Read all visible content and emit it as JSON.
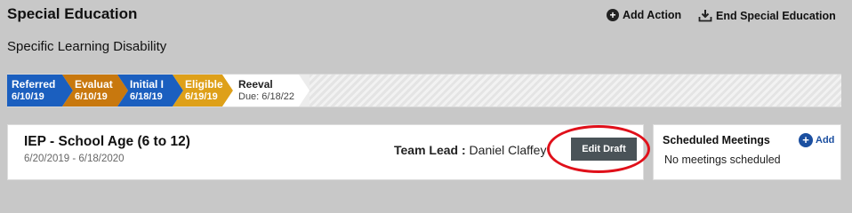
{
  "header": {
    "title": "Special Education",
    "subtitle": "Specific Learning Disability",
    "add_action": "Add Action",
    "end_special_education": "End Special Education"
  },
  "stages": [
    {
      "name": "Referred",
      "date": "6/10/19",
      "color": "#1b5fbf"
    },
    {
      "name": "Evaluat",
      "date": "6/10/19",
      "color": "#c8780e"
    },
    {
      "name": "Initial I",
      "date": "6/18/19",
      "color": "#1b5fbf"
    },
    {
      "name": "Eligible",
      "date": "6/19/19",
      "color": "#dea019"
    },
    {
      "name": "Reeval",
      "date": "Due: 6/18/22",
      "color": "#ffffff"
    }
  ],
  "iep": {
    "title": "IEP - School Age (6 to 12)",
    "dates": "6/20/2019 - 6/18/2020",
    "team_lead_label": "Team Lead :",
    "team_lead_name": "Daniel Claffey",
    "edit_draft": "Edit Draft"
  },
  "meetings": {
    "title": "Scheduled Meetings",
    "add": "Add",
    "empty": "No meetings scheduled"
  },
  "icons": {
    "add_action": "plus-circle-icon",
    "end_special_education": "download-tray-icon",
    "meetings_add": "plus-circle-icon"
  },
  "colors": {
    "highlight_ring": "#e0101a",
    "edit_button": "#4a5358",
    "link_blue": "#1b4fa0"
  }
}
